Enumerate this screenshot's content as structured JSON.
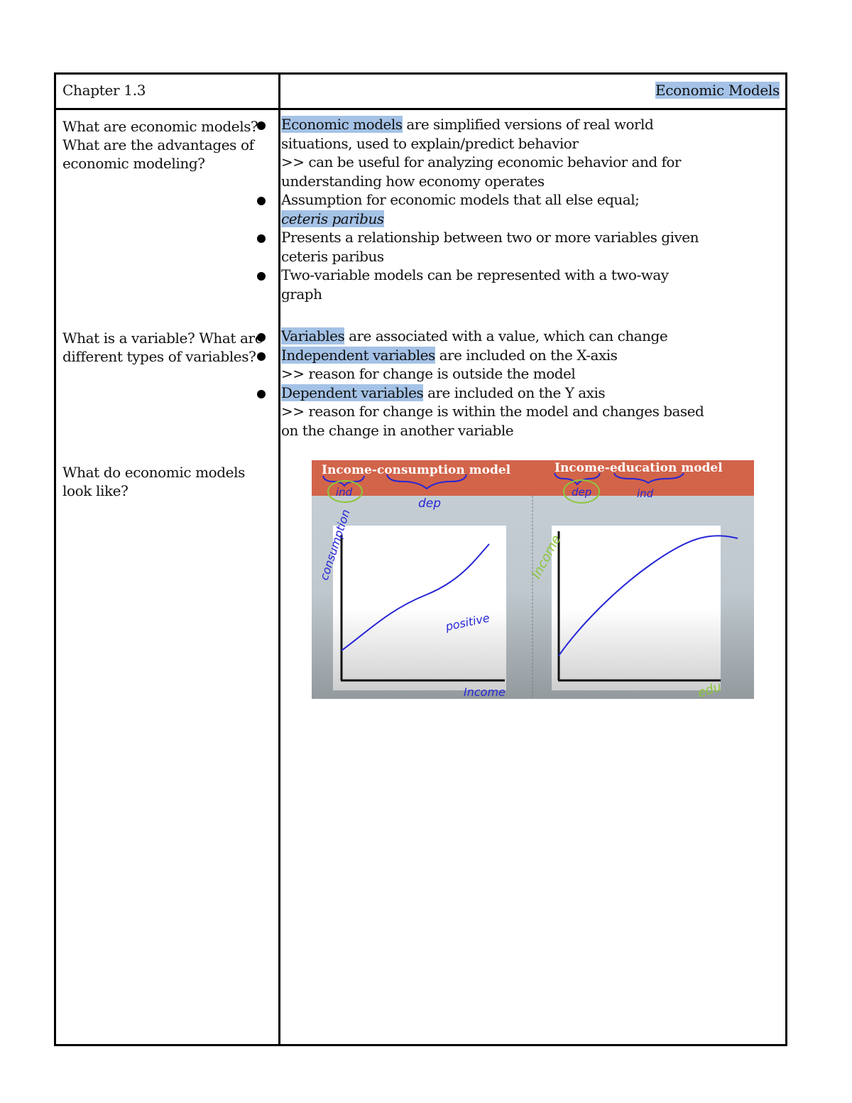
{
  "header": {
    "chapter": "Chapter 1.3",
    "topic": "Economic Models"
  },
  "sections": [
    {
      "question": "What are economic models? What are the advantages of economic modeling?",
      "bullets": [
        {
          "highlight": "Economic models",
          "text": " are simplified versions of real world situations, used to explain/predict behavior",
          "sub": ">>  can be useful for analyzing economic behavior and for understanding how economy operates"
        },
        {
          "text": "Assumption for economic models that all else equal;",
          "highlight_italic": "ceteris paribus"
        },
        {
          "text": "Presents a relationship between two or more variables given ceteris paribus"
        },
        {
          "text": "Two-variable models can be represented with a two-way graph"
        }
      ]
    },
    {
      "question": "What is a variable? What are different types of variables?",
      "bullets": [
        {
          "highlight": "Variables",
          "text": " are associated with a value, which can change"
        },
        {
          "highlight": "Independent variables",
          "text": " are included on the X-axis",
          "sub": ">>  reason for change is outside the model"
        },
        {
          "highlight": "Dependent variables",
          "text": " are included on the Y axis",
          "sub": ">> reason for change is within the model and changes based on the change in another variable"
        }
      ]
    },
    {
      "question": "What do economic models look like?"
    }
  ],
  "figure": {
    "colors": {
      "banner": "#d2644a",
      "panel_bg": "#c5ced4",
      "ink_blue": "#2626d6",
      "ink_green": "#8cc63a"
    },
    "left_panel": {
      "title": "Income-consumption model",
      "annotation_ind": "ind",
      "annotation_dep": "dep",
      "y_label": "consumption",
      "x_label": "Income",
      "note": "positive",
      "curve": "linear increasing"
    },
    "right_panel": {
      "title": "Income-education model",
      "annotation_dep": "dep",
      "annotation_ind": "ind",
      "y_label": "Income",
      "x_label": "edu",
      "curve": "concave increasing"
    }
  }
}
